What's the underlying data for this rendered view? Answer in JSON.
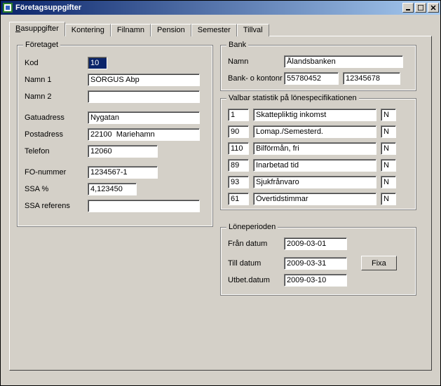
{
  "window": {
    "title": "Företagsuppgifter"
  },
  "tabs": [
    "Basuppgifter",
    "Kontering",
    "Filnamn",
    "Pension",
    "Semester",
    "Tillval"
  ],
  "company": {
    "legend": "Företaget",
    "labels": {
      "kod": "Kod",
      "namn1": "Namn 1",
      "namn2": "Namn 2",
      "gatuadress": "Gatuadress",
      "postadress": "Postadress",
      "telefon": "Telefon",
      "fo": "FO-nummer",
      "ssapct": "SSA %",
      "ssaref": "SSA referens"
    },
    "values": {
      "kod": "10",
      "namn1": "SÖRGUS Abp",
      "namn2": "",
      "gatuadress": "Nygatan",
      "postadress": "22100  Mariehamn",
      "telefon": "12060",
      "fo": "1234567-1",
      "ssapct": "4,123450",
      "ssaref": ""
    }
  },
  "bank": {
    "legend": "Bank",
    "labels": {
      "namn": "Namn",
      "kontonr": "Bank- o kontonr"
    },
    "values": {
      "namn": "Ålandsbanken",
      "bank": "55780452",
      "konto": "12345678"
    }
  },
  "stats": {
    "legend": "Valbar statistik på lönespecifikationen",
    "rows": [
      {
        "code": "1",
        "text": "Skattepliktig inkomst",
        "flag": "N"
      },
      {
        "code": "90",
        "text": "Lomap./Semesterd.",
        "flag": "N"
      },
      {
        "code": "110",
        "text": "Bilförmån, fri",
        "flag": "N"
      },
      {
        "code": "89",
        "text": "Inarbetad tid",
        "flag": "N"
      },
      {
        "code": "93",
        "text": "Sjukfrånvaro",
        "flag": "N"
      },
      {
        "code": "61",
        "text": "Övertidstimmar",
        "flag": "N"
      }
    ]
  },
  "period": {
    "legend": "Löneperioden",
    "labels": {
      "from": "Från datum",
      "to": "Till datum",
      "pay": "Utbet.datum",
      "fixa": "Fixa"
    },
    "values": {
      "from": "2009-03-01",
      "to": "2009-03-31",
      "pay": "2009-03-10"
    }
  }
}
